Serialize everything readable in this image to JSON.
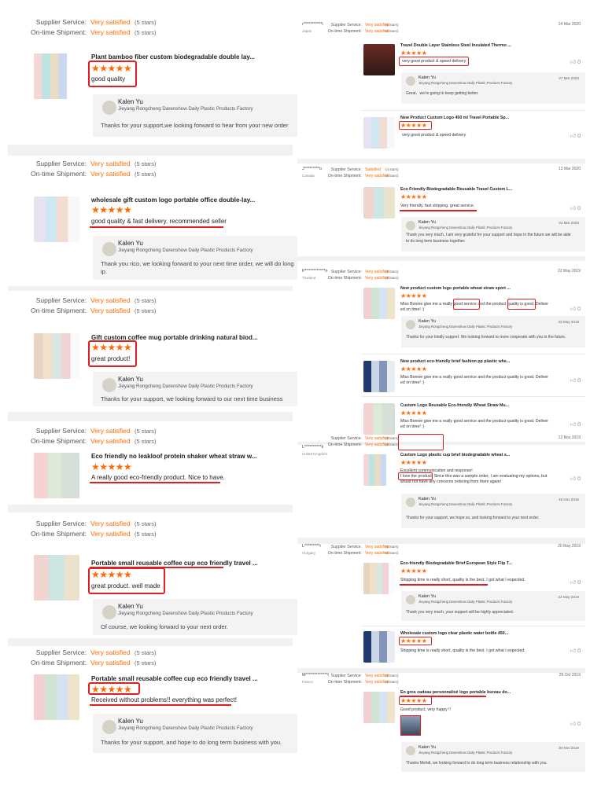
{
  "labels": {
    "supplier": "Supplier Service:",
    "shipment": "On-time Shipment:"
  },
  "left": [
    {
      "supplier": "Very satisfied",
      "supplier_n": "(5 stars)",
      "shipment": "Very satisfied",
      "shipment_n": "(5 stars)",
      "title": "Plant bamboo fiber custom biodegradable double lay...",
      "stars": "★★★★★",
      "comment": "good quality",
      "reply_name": "Kalen Yu",
      "reply_company": "Jieyang Rongcheng Darenshow Daily Plastic Products Factory",
      "reply_text": "Thanks for your support,we looking forward to hear from your new order"
    },
    {
      "supplier": "Very satisfied",
      "supplier_n": "(5 stars)",
      "shipment": "Very satisfied",
      "shipment_n": "(5 stars)",
      "title": "wholesale gift custom logo portable office double-lay...",
      "stars": "★★★★★",
      "comment": "good quality & fast delivery. recommended seller",
      "reply_name": "Kalen Yu",
      "reply_company": "Jieyang Rongcheng Darenshow Daily Plastic Products Factory",
      "reply_text": "Thank you rico, we looking forward to your next time order, we will do long",
      "reply_text2": "ip."
    },
    {
      "supplier": "Very satisfied",
      "supplier_n": "(5 stars)",
      "shipment": "Very satisfied",
      "shipment_n": "(5 stars)",
      "title": "Gift custom coffee mug portable drinking natural biod...",
      "stars": "★★★★★",
      "comment": "great product!",
      "reply_name": "Kalen Yu",
      "reply_company": "Jieyang Rongcheng Darenshow Daily Plastic Products Factory",
      "reply_text": "Thanks for your support, we looking forward to our next time business"
    },
    {
      "supplier": "Very satisfied",
      "supplier_n": "(5 stars)",
      "shipment": "Very satisfied",
      "shipment_n": "(5 stars)",
      "title": "Eco friendly no leakloof protein shaker wheat straw w...",
      "stars": "★★★★★",
      "comment": "A really good eco-friendly product. Nice to have."
    },
    {
      "supplier": "Very satisfied",
      "supplier_n": "(5 stars)",
      "shipment": "Very satisfied",
      "shipment_n": "(5 stars)",
      "title": "Portable small reusable coffee cup eco friendly travel ...",
      "stars": "★★★★★",
      "comment": "great product. well made",
      "reply_name": "Kalen Yu",
      "reply_company": "Jieyang Rongcheng Darenshow Daily Plastic Products Factory",
      "reply_text": "Of course, we looking forward to your next order."
    },
    {
      "supplier": "Very satisfied",
      "supplier_n": "(5 stars)",
      "shipment": "Very satisfied",
      "shipment_n": "(5 stars)",
      "title": "Portable small reusable coffee cup eco friendly travel ...",
      "stars": "★★★★★",
      "comment": "Received without problems!! everything was perfect!",
      "reply_name": "Kalen Yu",
      "reply_company": "Jieyang Rongcheng Darenshow Daily Plastic Products Factory",
      "reply_text": "Thanks for your support, and hope to do long term business with you."
    }
  ],
  "right": [
    {
      "name": "r***********i",
      "country": "Japan",
      "supplier": "Very satisfied",
      "supplier_n": "(5 stars)",
      "shipment": "Very satisfied",
      "shipment_n": "(5 stars)",
      "date": "24 Mar 2020",
      "items": [
        {
          "title": "Travel Double Layer Stainless Steel Insulated Thermo ...",
          "stars": "★★★★★",
          "comment": "very good product & speed delivery",
          "likes": "0",
          "reply_name": "Kalen Yu",
          "reply_company": "Jieyang Rongcheng Darenshow Daily Plastic Products Factory",
          "reply_date": "27 Mar 2020",
          "reply_text": "Great、we're going to keep getting better."
        },
        {
          "title": "New Product Custom Logo 450 ml Travel Portable Sp...",
          "stars": "★★★★★",
          "comment": "very good product & speed delivery",
          "likes": "0"
        }
      ]
    },
    {
      "name": "J*********o",
      "country": "Canada",
      "supplier": "Satisfied",
      "supplier_n": "(4 stars)",
      "shipment": "Very satisfied",
      "shipment_n": "(5 stars)",
      "date": "13 Mar 2020",
      "items": [
        {
          "title": "Eco Friendly Biodegradable Reusable Travel Custom L...",
          "stars": "★★★★★",
          "comment": "Very friendly. fast shipping. great service.",
          "likes": "0",
          "reply_name": "Kalen Yu",
          "reply_company": "Jieyang Rongcheng Darenshow Daily Plastic Products Factory",
          "reply_date": "24 Mar 2020",
          "reply_text": "Thank you very much, I am very grateful for your support and hope in the future we will be able",
          "reply_text2": "to do long term business together."
        }
      ]
    },
    {
      "name": "P************n",
      "country": "Thailand",
      "supplier": "Very satisfied",
      "supplier_n": "(5 stars)",
      "shipment": "Very satisfied",
      "shipment_n": "(5 stars)",
      "date": "22 May 2019",
      "items": [
        {
          "title": "New product custom logo portable wheat straw sport ...",
          "stars": "★★★★★",
          "comment": "Miss Bonnie give me a really good service and the product quality is good. Deliver",
          "comment2": "ed on time! :)",
          "likes": "0",
          "reply_name": "Kalen Yu",
          "reply_company": "Jieyang Rongcheng Darenshow Daily Plastic Products Factory",
          "reply_date": "23 May 2019",
          "reply_text": "Thanks for your kindly support. We looking forward to more cooperate with you in the future."
        },
        {
          "title": "New product eco-friendly brief fashion pp plastic whe...",
          "stars": "★★★★★",
          "comment": "Miss Bonnie give me a really good service and the product quality is good. Deliver",
          "comment2": "ed on time! :)",
          "likes": "0"
        },
        {
          "title": "Custom Logo Reusable Eco-friendly Wheat Straw Mu...",
          "stars": "★★★★★",
          "comment": "Miss Bonnie give me a really good service and the product quality is good. Deliver",
          "comment2": "ed on time! :)",
          "likes": "0"
        }
      ]
    },
    {
      "name": "L**********k",
      "country": "United Kingdom",
      "supplier": "Very satisfied",
      "supplier_n": "(5 stars)",
      "shipment": "Very satisfied",
      "shipment_n": "(5 stars)",
      "date": "12 Nov 2019",
      "items": [
        {
          "title": "Custom Logo plastic cup brief biodegradable wheat s...",
          "stars": "★★★★★",
          "comment": "Excellent communication and response!",
          "comment2": "I love the product! Since this was a sample order, I am evaluating my options, but",
          "comment3": "would not have any concerns ordering from them again!",
          "likes": "0",
          "reply_name": "Kalen Yu",
          "reply_company": "Jieyang Rongcheng Darenshow Daily Plastic Products Factory",
          "reply_date": "16 Nov 2019",
          "reply_text": "Thanks for your support, we hope so, and looking forward to your next order."
        }
      ]
    },
    {
      "name": "L*********r",
      "country": "Hungary",
      "supplier": "Very satisfied",
      "supplier_n": "(5 stars)",
      "shipment": "Very satisfied",
      "shipment_n": "(5 stars)",
      "date": "20 May 2019",
      "items": [
        {
          "title": "Eco-friendly Biodegradable Brief European Style Flip T...",
          "stars": "★★★★★",
          "comment": "Shipping time is really short, quality is the best. I got what I expected.",
          "likes": "0",
          "reply_name": "Kalen Yu",
          "reply_company": "Jieyang Rongcheng Darenshow Daily Plastic Products Factory",
          "reply_date": "22 May 2019",
          "reply_text": "Thank you very much, your support will be highly appreciated."
        },
        {
          "title": "Wholesale custom logo clear plastic water bottle 450...",
          "stars": "★★★★★",
          "comment": "Shipping time is really short, quality is the best. I got what I expected.",
          "likes": "0"
        }
      ]
    },
    {
      "name": "M*************t",
      "country": "France",
      "supplier": "Very satisfied",
      "supplier_n": "(5 stars)",
      "shipment": "Very satisfied",
      "shipment_n": "(5 stars)",
      "date": "29 Oct 2019",
      "items": [
        {
          "title": "En gros cadeau personnalisé logo portable bureau do...",
          "stars": "★★★★★",
          "comment": "Good product, very happy !!",
          "likes": "0",
          "reply_name": "Kalen Yu",
          "reply_company": "Jieyang Rongcheng Darenshow Daily Plastic Products Factory",
          "reply_date": "30 Nov 2019",
          "reply_text": "Thanks Mehdi, we looking forward to do long term business relationship with you."
        }
      ]
    }
  ],
  "colors": {
    "accent": "#ff6a00",
    "highlight": "#e02020",
    "gap": "#f1f1f1",
    "reply_bg": "#f3f3f3"
  },
  "icons": {
    "star": "star-icon",
    "like": "thumbs-up-icon",
    "avatar": "avatar"
  }
}
